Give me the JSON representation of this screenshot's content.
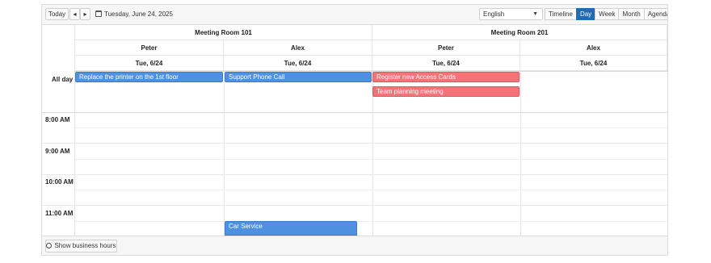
{
  "toolbar": {
    "today_label": "Today",
    "prev_label": "◂",
    "next_label": "▸",
    "date_label": "Tuesday, June 24, 2025",
    "language": "English",
    "views": [
      {
        "label": "Timeline",
        "active": false
      },
      {
        "label": "Day",
        "active": true
      },
      {
        "label": "Week",
        "active": false
      },
      {
        "label": "Month",
        "active": false
      },
      {
        "label": "Agenda",
        "active": false
      }
    ]
  },
  "rooms": [
    {
      "name": "Meeting Room 101"
    },
    {
      "name": "Meeting Room 201"
    }
  ],
  "resources": [
    {
      "name": "Peter",
      "date": "Tue, 6/24"
    },
    {
      "name": "Alex",
      "date": "Tue, 6/24"
    },
    {
      "name": "Peter",
      "date": "Tue, 6/24"
    },
    {
      "name": "Alex",
      "date": "Tue, 6/24"
    }
  ],
  "all_day_label": "All day",
  "time_slots": [
    "8:00 AM",
    "9:00 AM",
    "10:00 AM",
    "11:00 AM"
  ],
  "events": {
    "e1": "Replace the printer on the 1st floor",
    "e2": "Support Phone Call",
    "e3": "Register new Access Cards",
    "e4": "Team planning meeting",
    "e5": "Car Service"
  },
  "colors": {
    "blue_event": "#4f91e0",
    "red_event": "#f47378",
    "active_view": "#1f6db0"
  },
  "footer": {
    "business_hours_label": "Show business hours"
  }
}
